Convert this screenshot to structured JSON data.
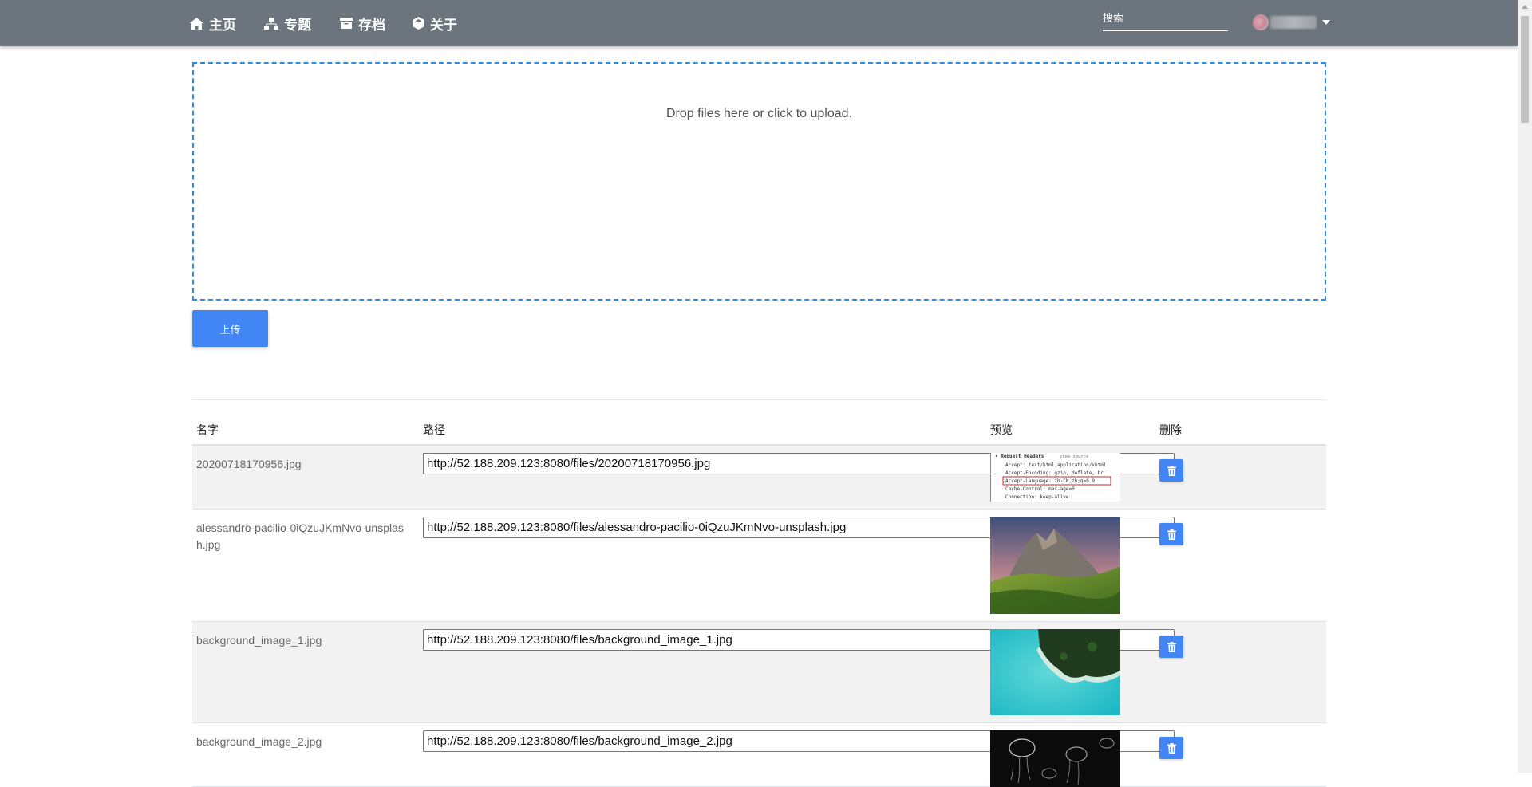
{
  "nav": {
    "items": [
      {
        "label": "主页",
        "icon": "home-icon"
      },
      {
        "label": "专题",
        "icon": "sitemap-icon"
      },
      {
        "label": "存档",
        "icon": "archive-icon"
      },
      {
        "label": "关于",
        "icon": "cube-icon"
      }
    ],
    "search_placeholder": "搜索"
  },
  "colors": {
    "navbar": "#6c757d",
    "primary": "#4285f4",
    "dropzone_border": "#2b8be6",
    "row_stripe": "#f2f2f2"
  },
  "dropzone": {
    "message": "Drop files here or click to upload."
  },
  "upload_button": "上传",
  "table": {
    "headers": [
      "名字",
      "路径",
      "预览",
      "删除"
    ],
    "rows": [
      {
        "name": "20200718170956.jpg",
        "path": "http://52.188.209.123:8080/files/20200718170956.jpg",
        "preview": "screenshot-request-headers"
      },
      {
        "name": "alessandro-pacilio-0iQzuJKmNvo-unsplash.jpg",
        "path": "http://52.188.209.123:8080/files/alessandro-pacilio-0iQzuJKmNvo-unsplash.jpg",
        "preview": "mountain-landscape"
      },
      {
        "name": "background_image_1.jpg",
        "path": "http://52.188.209.123:8080/files/background_image_1.jpg",
        "preview": "aerial-sea-coast"
      },
      {
        "name": "background_image_2.jpg",
        "path": "http://52.188.209.123:8080/files/background_image_2.jpg",
        "preview": "jellyfish-dark"
      }
    ]
  },
  "preview_text": {
    "title": "▾ Request Headers",
    "view_source": "view source",
    "lines": [
      "Accept: text/html,application/xhtml",
      "Accept-Encoding: gzip, deflate, br",
      "Accept-Language: zh-CN,zh;q=0.9",
      "Cache-Control: max-age=0",
      "Connection: keep-alive"
    ]
  }
}
